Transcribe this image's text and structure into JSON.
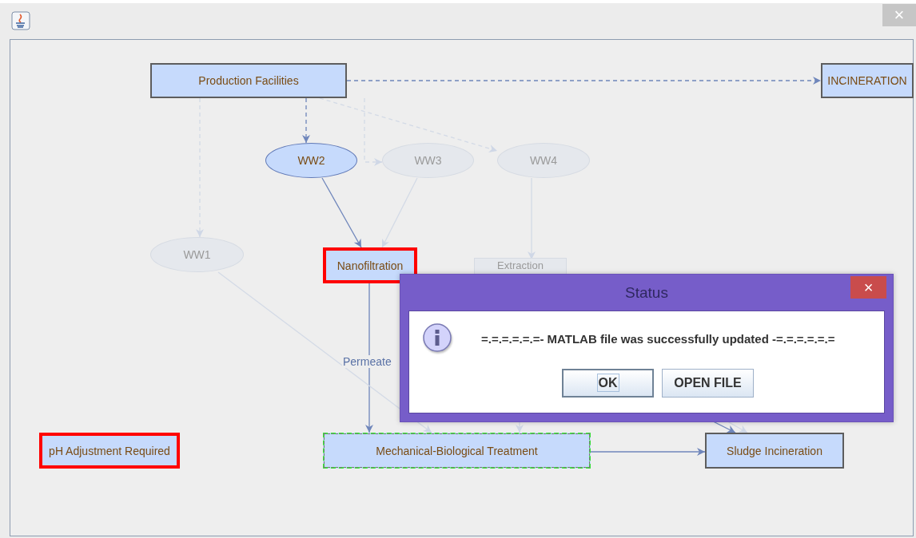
{
  "window": {
    "close": "×"
  },
  "nodes": [
    {
      "label": "Production Facilities",
      "kind": "rect",
      "faded": false,
      "error": false,
      "selected": false
    },
    {
      "label": "INCINERATION",
      "kind": "rect",
      "faded": false,
      "error": false,
      "selected": false
    },
    {
      "label": "WW2",
      "kind": "ellipse",
      "faded": false,
      "error": false,
      "selected": false
    },
    {
      "label": "WW3",
      "kind": "ellipse",
      "faded": true,
      "error": false,
      "selected": false
    },
    {
      "label": "WW4",
      "kind": "ellipse",
      "faded": true,
      "error": false,
      "selected": false
    },
    {
      "label": "WW1",
      "kind": "ellipse",
      "faded": true,
      "error": false,
      "selected": false
    },
    {
      "label": "Nanofiltration",
      "kind": "rect",
      "faded": false,
      "error": true,
      "selected": false
    },
    {
      "label": "Extraction",
      "kind": "rect",
      "faded": true,
      "error": false,
      "selected": false
    },
    {
      "label": "pH Adjustment Required",
      "kind": "rect",
      "faded": false,
      "error": true,
      "selected": false
    },
    {
      "label": "Mechanical-Biological Treatment",
      "kind": "rect",
      "faded": false,
      "error": false,
      "selected": true
    },
    {
      "label": "Sludge Incineration",
      "kind": "rect",
      "faded": false,
      "error": false,
      "selected": false
    }
  ],
  "edges": [
    {
      "dashed": true,
      "faded": false
    },
    {
      "dashed": true,
      "faded": false
    },
    {
      "dashed": true,
      "faded": true
    },
    {
      "dashed": true,
      "faded": true
    },
    {
      "dashed": true,
      "faded": true
    },
    {
      "dashed": false,
      "faded": false
    },
    {
      "dashed": false,
      "faded": true
    },
    {
      "dashed": false,
      "faded": true
    },
    {
      "dashed": false,
      "faded": false,
      "label": "Permeate"
    },
    {
      "dashed": false,
      "faded": true
    },
    {
      "dashed": false,
      "faded": false
    },
    {
      "dashed": false,
      "faded": false
    },
    {
      "dashed": false,
      "faded": true
    },
    {
      "dashed": false,
      "faded": true
    }
  ],
  "dialog": {
    "title": "Status",
    "close": "×",
    "message": "=.=.=.=.=.=- MATLAB file was successfully updated -=.=.=.=.=.=",
    "buttons": [
      {
        "label": "OK",
        "focused": true
      },
      {
        "label": "OPEN FILE",
        "focused": false
      }
    ]
  }
}
